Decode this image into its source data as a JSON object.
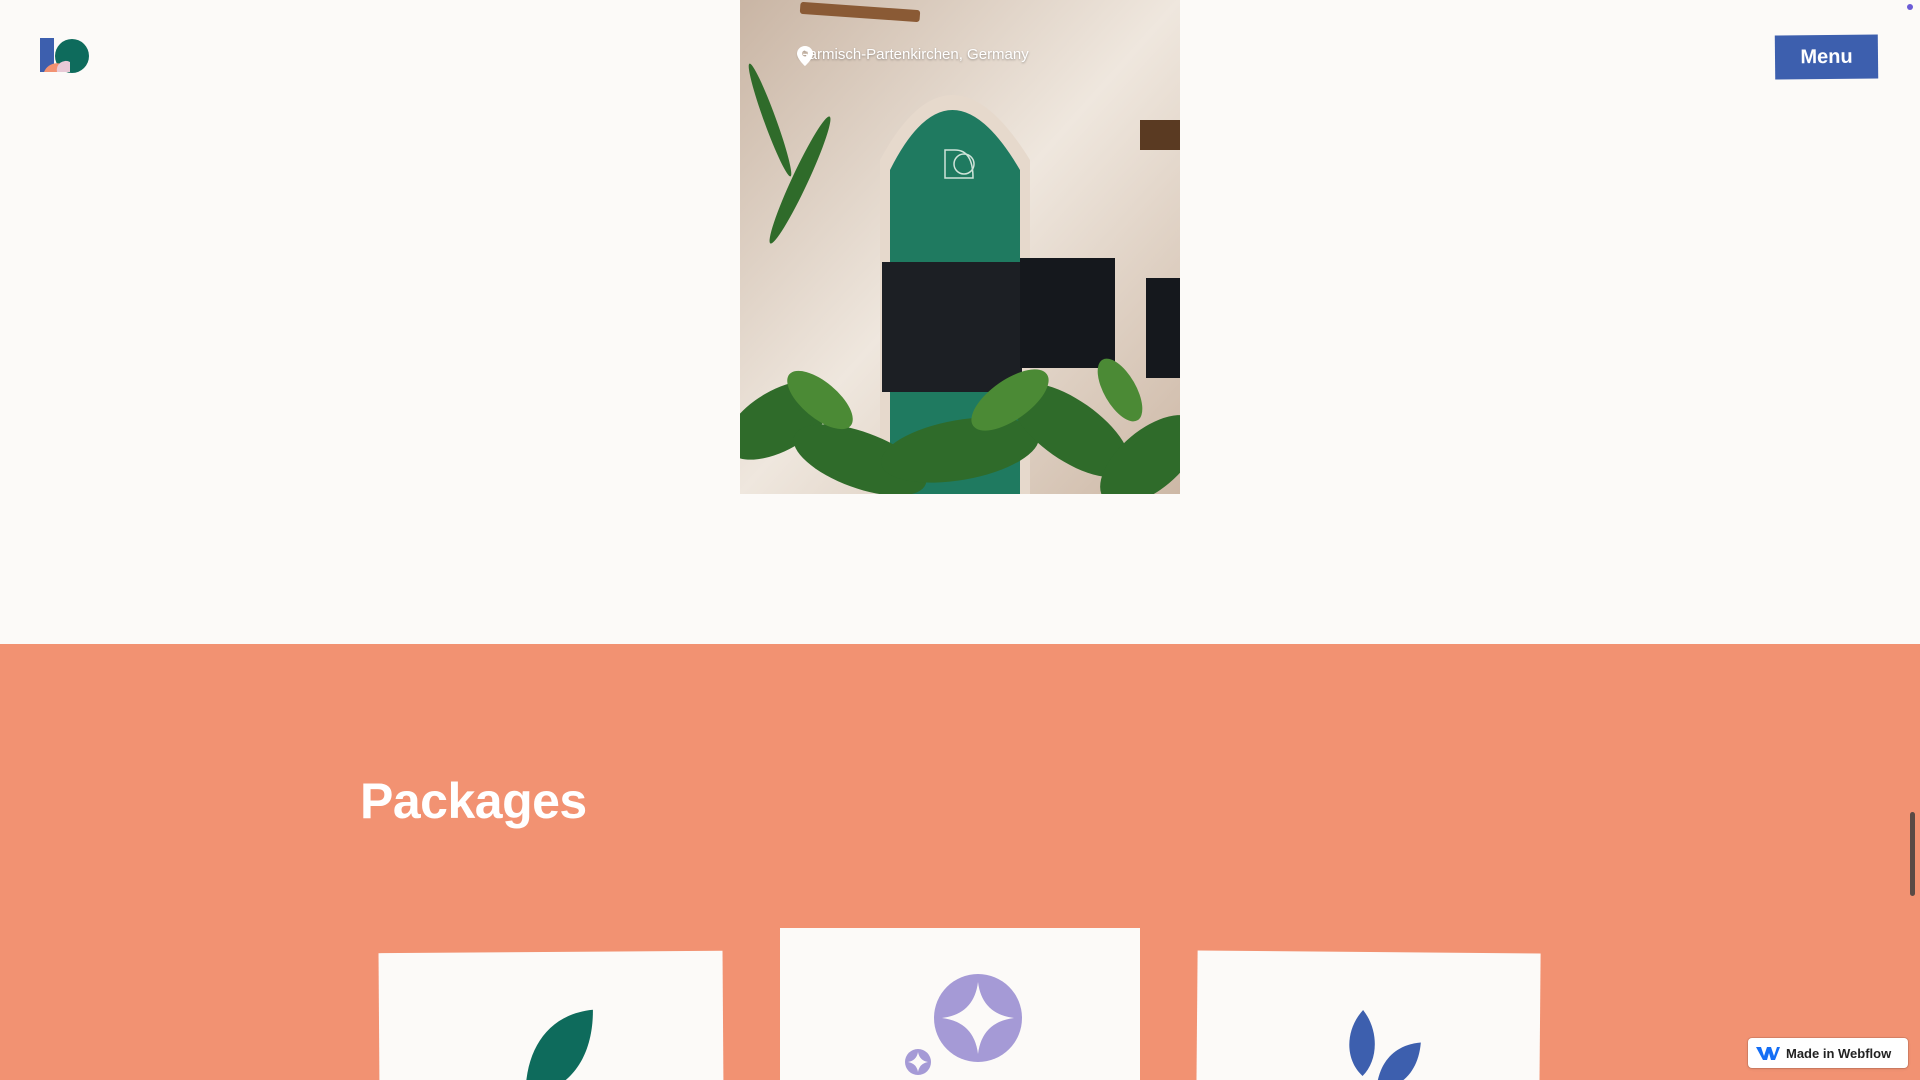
{
  "header": {
    "logo_icon": "ko-logo",
    "menu_label": "Menu"
  },
  "hero_photo": {
    "icon": "location-pin-icon",
    "location": "Garmisch-Partenkirchen, Germany"
  },
  "packages": {
    "title": "Packages",
    "cards": [
      {
        "icon": "leaf-icon"
      },
      {
        "icon": "sparkle-star-icon"
      },
      {
        "icon": "sprout-icon"
      }
    ]
  },
  "badge": {
    "label": "Made in Webflow",
    "icon": "webflow-logo-icon"
  },
  "colors": {
    "background": "#fcfaf8",
    "accent_blue": "#3d5fae",
    "packages_bg": "#f29272",
    "green": "#0e6b5c",
    "lavender": "#a59ad6"
  }
}
